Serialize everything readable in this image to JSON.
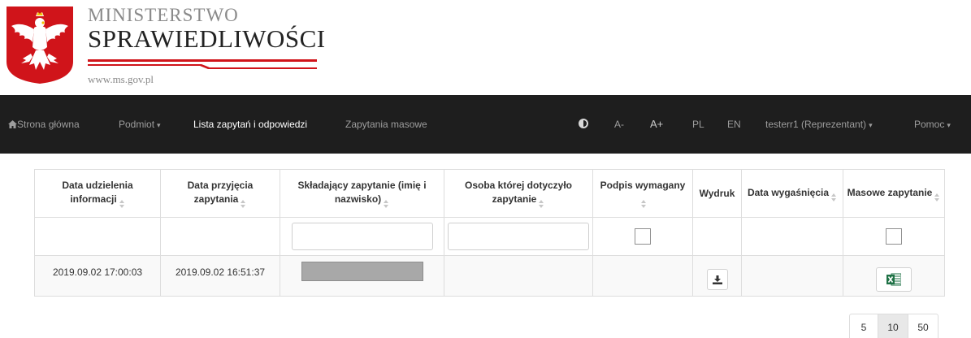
{
  "header": {
    "brand_line1": "MINISTERSTWO",
    "brand_line2": "SPRAWIEDLIWOŚCI",
    "url": "www.ms.gov.pl",
    "brand_red": "#d0141a"
  },
  "navbar": {
    "home": "Strona główna",
    "subject": "Podmiot",
    "requests_list": "Lista zapytań i odpowiedzi",
    "bulk_requests": "Zapytania masowe",
    "font_smaller": "A-",
    "font_larger": "A+",
    "lang_pl": "PL",
    "lang_en": "EN",
    "user": "testerr1 (Reprezentant)",
    "help": "Pomoc",
    "caret": "▾"
  },
  "table": {
    "headers": {
      "c1": "Data udzielenia informacji",
      "c2": "Data przyjęcia zapytania",
      "c3": "Składający zapytanie (imię i nazwisko)",
      "c4": "Osoba której dotyczyło zapytanie",
      "c5": "Podpis wymagany",
      "c6": "Wydruk",
      "c7": "Data wygaśnięcia",
      "c8": "Masowe zapytanie"
    },
    "rows": [
      {
        "info_date": "2019.09.02 17:00:03",
        "received_date": "2019.09.02 16:51:37"
      }
    ]
  },
  "pagination": {
    "sizes": [
      "5",
      "10",
      "50"
    ],
    "active": "10"
  },
  "icons": {
    "home": "home-icon",
    "contrast": "contrast-icon",
    "download": "download-icon",
    "excel": "excel-icon"
  }
}
